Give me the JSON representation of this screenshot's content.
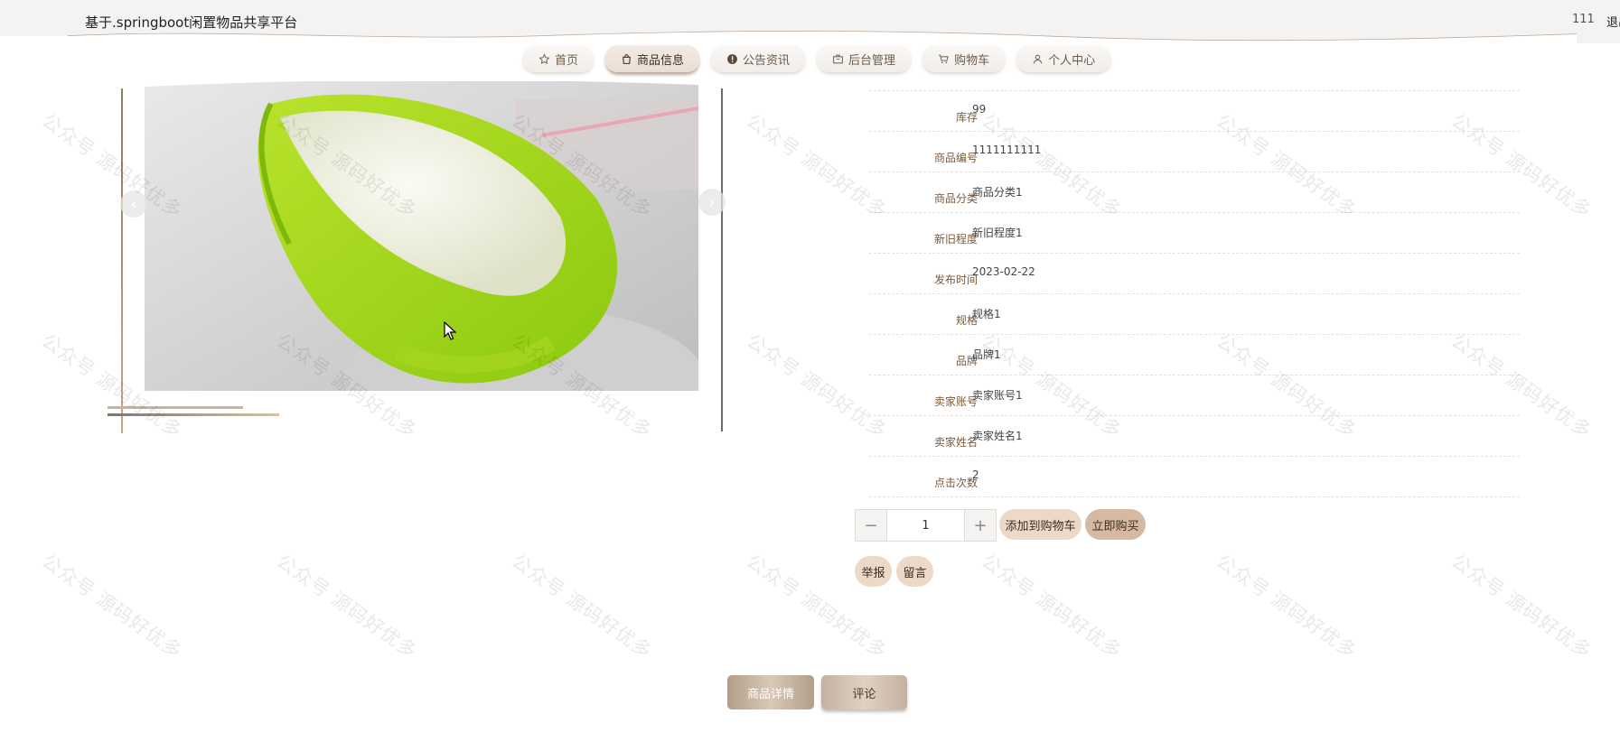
{
  "header": {
    "title": "基于.springboot闲置物品共享平台",
    "username": "111",
    "logout": "退出"
  },
  "nav": [
    {
      "label": "首页",
      "icon": "star-icon"
    },
    {
      "label": "商品信息",
      "icon": "bag-icon",
      "active": true
    },
    {
      "label": "公告资讯",
      "icon": "info-icon"
    },
    {
      "label": "后台管理",
      "icon": "box-icon"
    },
    {
      "label": "购物车",
      "icon": "cart-icon"
    },
    {
      "label": "个人中心",
      "icon": "user-icon"
    }
  ],
  "watermark": "公众号 源码好优多",
  "gallery": {
    "prev_icon": "chevron-left-icon",
    "next_icon": "chevron-right-icon"
  },
  "details": [
    {
      "label": "库存",
      "value": "99"
    },
    {
      "label": "商品编号",
      "value": "1111111111"
    },
    {
      "label": "商品分类",
      "value": "商品分类1"
    },
    {
      "label": "新旧程度",
      "value": "新旧程度1"
    },
    {
      "label": "发布时间",
      "value": "2023-02-22"
    },
    {
      "label": "规格",
      "value": "规格1"
    },
    {
      "label": "品牌",
      "value": "品牌1"
    },
    {
      "label": "卖家账号",
      "value": "卖家账号1"
    },
    {
      "label": "卖家姓名",
      "value": "卖家姓名1"
    },
    {
      "label": "点击次数",
      "value": "2"
    }
  ],
  "buy": {
    "minus": "−",
    "quantity": "1",
    "plus": "+",
    "add_to_cart": "添加到购物车",
    "buy_now": "立即购买",
    "report": "举报",
    "message": "留言"
  },
  "tabs": {
    "detail": "商品详情",
    "comments": "评论"
  },
  "colors": {
    "accent": "#d5b9a3",
    "header_bg": "#f5f3f1",
    "label": "#7a5a3c"
  }
}
